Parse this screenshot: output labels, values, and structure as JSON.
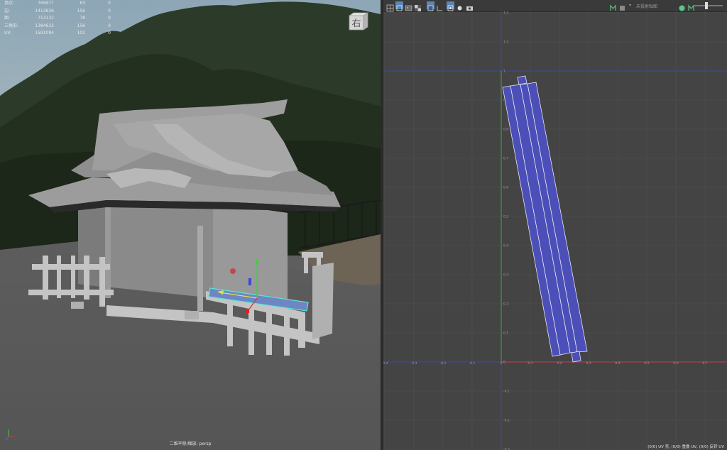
{
  "hud": {
    "rows": [
      {
        "label": "顶点:",
        "v1": "769977",
        "v2": "63",
        "v3": "0"
      },
      {
        "label": "边:",
        "v1": "1413636",
        "v2": "156",
        "v3": "0"
      },
      {
        "label": "面:",
        "v1": "713132",
        "v2": "78",
        "v3": "0"
      },
      {
        "label": "三角形:",
        "v1": "1384632",
        "v2": "156",
        "v3": "0"
      },
      {
        "label": "UV:",
        "v1": "1591094",
        "v2": "102",
        "v3": "0"
      }
    ]
  },
  "viewcube": {
    "label": "右"
  },
  "viewport": {
    "camera_label": "二维平移/缩放: persp"
  },
  "uv_editor": {
    "toolbar": {
      "search_text": "未投射贴图"
    },
    "status": "(0/0) UV 壳, (0/0) 重叠 UV, (0/0) 反转 UV",
    "x_ticks": [
      "-0.4",
      "-0.3",
      "-0.2",
      "-0.1",
      "0",
      "0.1",
      "0.2",
      "0.3",
      "0.4",
      "0.5",
      "0.6",
      "0.7"
    ],
    "y_ticks": [
      "1.2",
      "1.1",
      "1",
      "0.9",
      "0.8",
      "0.7",
      "0.6",
      "0.5",
      "0.4",
      "0.3",
      "0.2",
      "0.1",
      "0",
      "-0.1",
      "-0.2",
      "-0.3"
    ]
  },
  "colors": {
    "uv_fill": "#4b4fb7",
    "uv_edge": "#e6e6f5",
    "grid": "#505050",
    "u_axis": "#c0404d",
    "v_axis": "#3fa845",
    "border": "#3f4a9a"
  }
}
